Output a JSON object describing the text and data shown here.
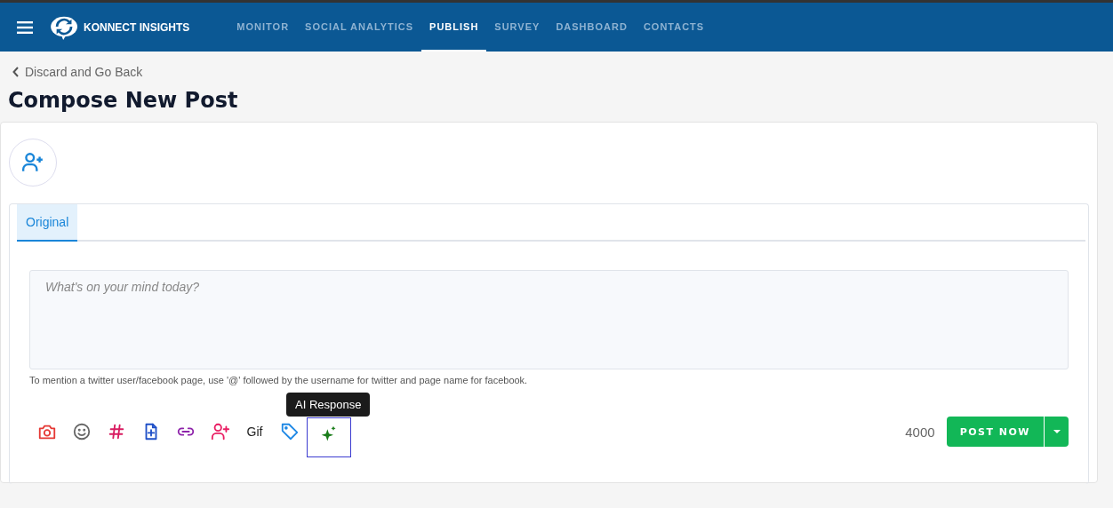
{
  "header": {
    "logo_text": "KONNECT INSIGHTS",
    "nav": [
      {
        "label": "MONITOR",
        "selected": false
      },
      {
        "label": "SOCIAL ANALYTICS",
        "selected": false
      },
      {
        "label": "PUBLISH",
        "selected": true
      },
      {
        "label": "SURVEY",
        "selected": false
      },
      {
        "label": "DASHBOARD",
        "selected": false
      },
      {
        "label": "CONTACTS",
        "selected": false
      }
    ]
  },
  "back_link": "Discard and Go Back",
  "page_title": "Compose New Post",
  "tabs": [
    {
      "label": "Original",
      "selected": true
    }
  ],
  "composer": {
    "placeholder": "What's on your mind today?",
    "hint": "To mention a twitter user/facebook page, use '@' followed by the username for twitter and page name for facebook."
  },
  "toolbar": [
    {
      "kind": "camera",
      "focused": false
    },
    {
      "kind": "emoji",
      "focused": false
    },
    {
      "kind": "hashtag",
      "focused": false
    },
    {
      "kind": "file-add",
      "focused": false
    },
    {
      "kind": "link",
      "focused": false
    },
    {
      "kind": "user-add",
      "focused": false
    },
    {
      "kind": "gif",
      "label": "Gif",
      "focused": false
    },
    {
      "kind": "tag",
      "focused": false
    },
    {
      "kind": "sparkle",
      "focused": true,
      "tooltip": "AI Response"
    }
  ],
  "char_count": "4000",
  "post_button": "POST NOW"
}
